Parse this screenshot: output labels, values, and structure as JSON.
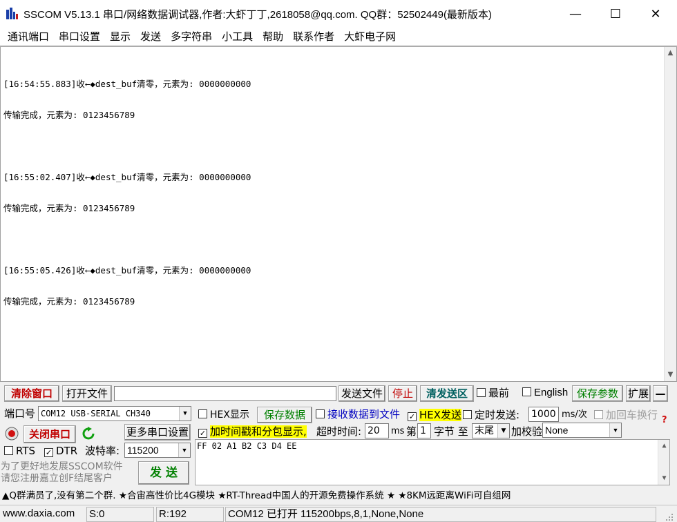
{
  "window": {
    "title": "SSCOM V5.13.1 串口/网络数据调试器,作者:大虾丁丁,2618058@qq.com. QQ群：52502449(最新版本)",
    "minimize_glyph": "—",
    "maximize_glyph": "☐",
    "close_glyph": "✕"
  },
  "menu": {
    "items": [
      "通讯端口",
      "串口设置",
      "显示",
      "发送",
      "多字符串",
      "小工具",
      "帮助",
      "联系作者",
      "大虾电子网"
    ]
  },
  "receive": {
    "lines": [
      "[16:54:55.883]收←◆dest_buf清零，元素为: 0000000000",
      "传输完成，元素为: 0123456789",
      "",
      "[16:55:02.407]收←◆dest_buf清零，元素为: 0000000000",
      "传输完成，元素为: 0123456789",
      "",
      "[16:55:05.426]收←◆dest_buf清零，元素为: 0000000000",
      "传输完成，元素为: 0123456789"
    ]
  },
  "toolbar": {
    "clear_window": "清除窗口",
    "open_file": "打开文件",
    "file_path": "",
    "send_file": "发送文件",
    "stop": "停止",
    "clear_send": "清发送区",
    "topmost": "最前",
    "english": "English",
    "save_params": "保存参数",
    "expand": "扩展",
    "collapse": "—"
  },
  "port": {
    "port_label": "端口号",
    "port_value": "COM12 USB-SERIAL CH340",
    "close_port": "关闭串口",
    "more_settings": "更多串口设置",
    "rts": "RTS",
    "dtr": "DTR",
    "baud_label": "波特率:",
    "baud_value": "115200"
  },
  "options": {
    "hex_display": "HEX显示",
    "save_data": "保存数据",
    "recv_to_file": "接收数据到文件",
    "hex_send": "HEX发送",
    "timed_send": "定时发送:",
    "interval": "1000",
    "interval_unit": "ms/次",
    "add_crlf": "加回车换行",
    "add_timestamp": "加时间戳和分包显示,",
    "timeout_label": "超时时间:",
    "timeout_value": "20",
    "timeout_unit": "ms",
    "byte_prefix": "第",
    "byte_index": "1",
    "byte_suffix": "字节 至",
    "end_value": "末尾",
    "checksum_label": "加校验",
    "checksum_value": "None"
  },
  "send": {
    "content": "FF 02 A1 B2 C3 D4 EE",
    "promo_line1": "为了更好地发展SSCOM软件",
    "promo_line2": "请您注册嘉立创F结尾客户",
    "send_button": "发 送"
  },
  "marquee": "▲Q群满员了,没有第二个群. ★合宙高性价比4G模块 ★RT-Thread中国人的开源免费操作系统 ★ ★8KM远距离WiFi可自组网",
  "status": {
    "website": "www.daxia.com",
    "sent": "S:0",
    "received": "R:192",
    "port_state": "COM12 已打开  115200bps,8,1,None,None"
  },
  "colors": {
    "accent_red": "#c00000",
    "accent_green": "#008000",
    "accent_blue": "#0000c0",
    "highlight": "#ffff00"
  }
}
